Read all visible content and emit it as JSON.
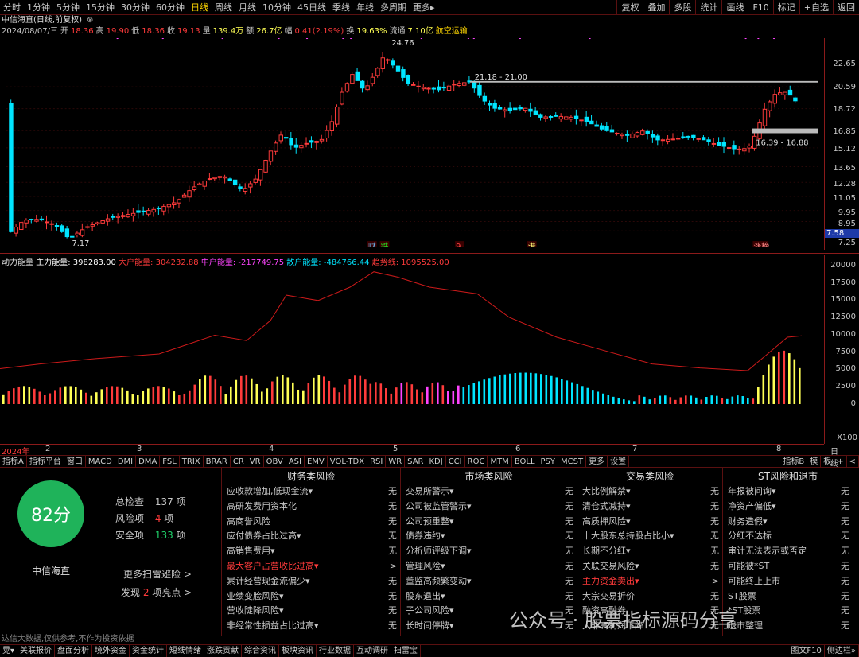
{
  "period_tabs": [
    {
      "label": "分时",
      "active": false
    },
    {
      "label": "1分钟",
      "active": false
    },
    {
      "label": "5分钟",
      "active": false
    },
    {
      "label": "15分钟",
      "active": false
    },
    {
      "label": "30分钟",
      "active": false
    },
    {
      "label": "60分钟",
      "active": false
    },
    {
      "label": "日线",
      "active": true
    },
    {
      "label": "周线",
      "active": false
    },
    {
      "label": "月线",
      "active": false
    },
    {
      "label": "10分钟",
      "active": false
    },
    {
      "label": "45日线",
      "active": false
    },
    {
      "label": "季线",
      "active": false
    },
    {
      "label": "年线",
      "active": false
    },
    {
      "label": "多周期",
      "active": false
    },
    {
      "label": "更多▸",
      "active": false
    }
  ],
  "right_tools": [
    "复权",
    "叠加",
    "多股",
    "统计",
    "画线",
    "F10",
    "标记",
    "+自选",
    "返回"
  ],
  "stock": {
    "title": "中信海直(日线,前复权)",
    "date": "2024/08/07/三",
    "open_label": "开",
    "open": "18.36",
    "high_label": "高",
    "high": "19.90",
    "low_label": "低",
    "low": "18.36",
    "close_label": "收",
    "close": "19.13",
    "vol_label": "量",
    "vol": "139.4万",
    "amt_label": "额",
    "amt": "26.7亿",
    "chg_label": "幅",
    "chg": "0.41(2.19%)",
    "turn_label": "换",
    "turn": "19.63%",
    "float_label": "流通",
    "float": "7.10亿",
    "sector": "航空运输"
  },
  "chart_annotations": {
    "high_mark": "24.76",
    "low_mark": "7.17",
    "zone1": "21.18 - 21.00",
    "zone2": "16.39 - 16.88",
    "events": [
      "财",
      "跌",
      "9",
      "港",
      "涨榜"
    ]
  },
  "price_axis": [
    "22.65",
    "20.59",
    "18.72",
    "16.85",
    "15.12",
    "13.65",
    "12.28",
    "11.05",
    "9.95",
    "8.95",
    "7.58",
    "7.25"
  ],
  "current_price_badge": "7.58",
  "indicator": {
    "name": "动力能量",
    "main_label": "主力能量",
    "main_val": "398283.00",
    "big_label": "大户能量",
    "big_val": "304232.88",
    "mid_label": "中户能量",
    "mid_val": "-217749.75",
    "small_label": "散户能量",
    "small_val": "-484766.44",
    "trend_label": "趋势线",
    "trend_val": "1095525.00"
  },
  "ind_axis": [
    "20000",
    "17500",
    "15000",
    "12500",
    "10000",
    "7500",
    "5000",
    "2500",
    "0"
  ],
  "ind_unit": "X100",
  "date_axis": {
    "labels": [
      "2024年",
      "2",
      "3",
      "4",
      "5",
      "6",
      "7",
      "8"
    ],
    "right": "日线"
  },
  "toolbar_items": [
    "指标A",
    "指标平台",
    "窗口",
    "MACD",
    "DMI",
    "DMA",
    "FSL",
    "TRIX",
    "BRAR",
    "CR",
    "VR",
    "OBV",
    "ASI",
    "EMV",
    "VOL-TDX",
    "RSI",
    "WR",
    "SAR",
    "KDJ",
    "CCI",
    "ROC",
    "MTM",
    "BOLL",
    "PSY",
    "MCST",
    "更多",
    "设置"
  ],
  "toolbar_right": [
    "指标B",
    "模",
    "板",
    "+",
    "<"
  ],
  "risk": {
    "score": "82分",
    "total_label": "总检查",
    "total": "137",
    "total_unit": "项",
    "risk_label": "风险项",
    "risk_count": "4",
    "risk_unit": "项",
    "safe_label": "安全项",
    "safe": "133",
    "safe_unit": "项",
    "name": "中信海直",
    "more": "更多扫雷避险 >",
    "find_pre": "发现",
    "find_num": "2",
    "find_post": "项亮点 >",
    "disclaimer": "达信大数据,仅供参考,不作为投资依据"
  },
  "columns": [
    {
      "title": "财务类风险",
      "rows": [
        [
          "应收款增加,低现金流▾",
          "无",
          false
        ],
        [
          "高研发费用资本化",
          "无",
          false
        ],
        [
          "高商誉风险",
          "无",
          false
        ],
        [
          "应付债券占比过高▾",
          "无",
          false
        ],
        [
          "高销售费用▾",
          "无",
          false
        ],
        [
          "最大客户占营收比过高▾",
          ">",
          true
        ],
        [
          "累计经营现金流偏少▾",
          "无",
          false
        ],
        [
          "业绩变脸风险▾",
          "无",
          false
        ],
        [
          "营收陡降风险▾",
          "无",
          false
        ],
        [
          "非经常性损益占比过高▾",
          "无",
          false
        ]
      ]
    },
    {
      "title": "市场类风险",
      "rows": [
        [
          "交易所警示▾",
          "无",
          false
        ],
        [
          "公司被监管警示▾",
          "无",
          false
        ],
        [
          "公司预重整▾",
          "无",
          false
        ],
        [
          "债券违约▾",
          "无",
          false
        ],
        [
          "分析师评级下调▾",
          "无",
          false
        ],
        [
          "管理风险▾",
          "无",
          false
        ],
        [
          "董监高频繁变动▾",
          "无",
          false
        ],
        [
          "股东退出▾",
          "无",
          false
        ],
        [
          "子公司风险▾",
          "无",
          false
        ],
        [
          "长时间停牌▾",
          "无",
          false
        ]
      ]
    },
    {
      "title": "交易类风险",
      "rows": [
        [
          "大比例解禁▾",
          "无",
          false
        ],
        [
          "清仓式减持▾",
          "无",
          false
        ],
        [
          "高质押风险▾",
          "无",
          false
        ],
        [
          "十大股东总持股占比小▾",
          "无",
          false
        ],
        [
          "长期不分红▾",
          "无",
          false
        ],
        [
          "关联交易风险▾",
          "无",
          false
        ],
        [
          "主力资金卖出▾",
          ">",
          true
        ],
        [
          "大宗交易折价",
          "无",
          false
        ],
        [
          "融资高融券",
          "无",
          false
        ],
        [
          "大非高利润下降",
          "无",
          false
        ]
      ]
    },
    {
      "title": "ST风险和退市",
      "rows": [
        [
          "年报被问询▾",
          "无",
          false
        ],
        [
          "净资产偏低▾",
          "无",
          false
        ],
        [
          "财务造假▾",
          "无",
          false
        ],
        [
          "分红不达标",
          "无",
          false
        ],
        [
          "审计无法表示或否定",
          "无",
          false
        ],
        [
          "可能被*ST",
          "无",
          false
        ],
        [
          "可能终止上市",
          "无",
          false
        ],
        [
          "ST股票",
          "无",
          false
        ],
        [
          "*ST股票",
          "无",
          false
        ],
        [
          "退市整理",
          "无",
          false
        ]
      ]
    }
  ],
  "bottom_items": [
    "晃▾",
    "关联报价",
    "盘面分析",
    "境外资金",
    "资金统计",
    "短线情绪",
    "涨跌贡献",
    "综合资讯",
    "板块资讯",
    "行业数据",
    "互动调研",
    "扫雷宝"
  ],
  "bottom_right": [
    "图文F10",
    "侧边栏»"
  ],
  "watermark": "公众号 · 股票指标源码分享",
  "colors": {
    "up": "#ff3b3b",
    "down": "#00e5ff",
    "yellow": "#ffff55",
    "magenta": "#ff44ff",
    "green": "#22dd22",
    "accent": "#ffd700",
    "score": "#1fb35a"
  }
}
